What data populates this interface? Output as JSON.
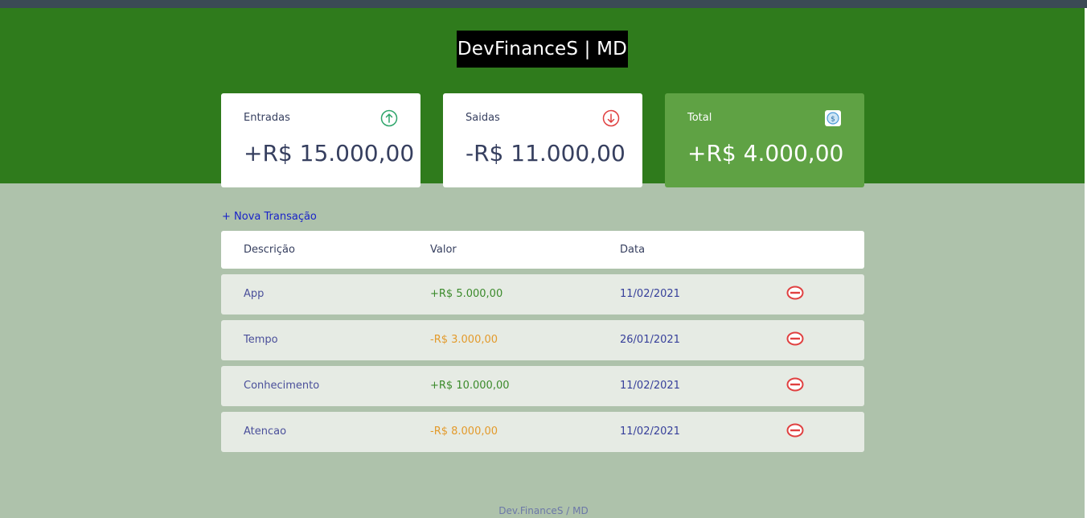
{
  "header": {
    "logo": "DevFinanceS | MD"
  },
  "cards": {
    "income": {
      "title": "Entradas",
      "value": "+R$ 15.000,00",
      "icon": "arrow-up-circle-icon"
    },
    "expense": {
      "title": "Saidas",
      "value": "-R$ 11.000,00",
      "icon": "arrow-down-circle-icon"
    },
    "total": {
      "title": "Total",
      "value": "+R$ 4.000,00",
      "icon": "dollar-icon"
    }
  },
  "actions": {
    "new_transaction": "+ Nova Transação"
  },
  "table": {
    "headers": [
      "Descrição",
      "Valor",
      "Data"
    ],
    "rows": [
      {
        "description": "App",
        "amount": "+R$ 5.000,00",
        "date": "11/02/2021",
        "type": "positive"
      },
      {
        "description": "Tempo",
        "amount": "-R$ 3.000,00",
        "date": "26/01/2021",
        "type": "negative"
      },
      {
        "description": "Conhecimento",
        "amount": "+R$ 10.000,00",
        "date": "11/02/2021",
        "type": "positive"
      },
      {
        "description": "Atencao",
        "amount": "-R$ 8.000,00",
        "date": "11/02/2021",
        "type": "negative"
      }
    ]
  },
  "footer": {
    "text": "Dev.FinanceS / MD"
  },
  "colors": {
    "header_bg": "#2f7b1c",
    "page_bg": "#aec2ab",
    "total_card": "#5fa244",
    "positive": "#3b8a2b",
    "negative": "#e39a2b",
    "delete": "#e04040"
  }
}
